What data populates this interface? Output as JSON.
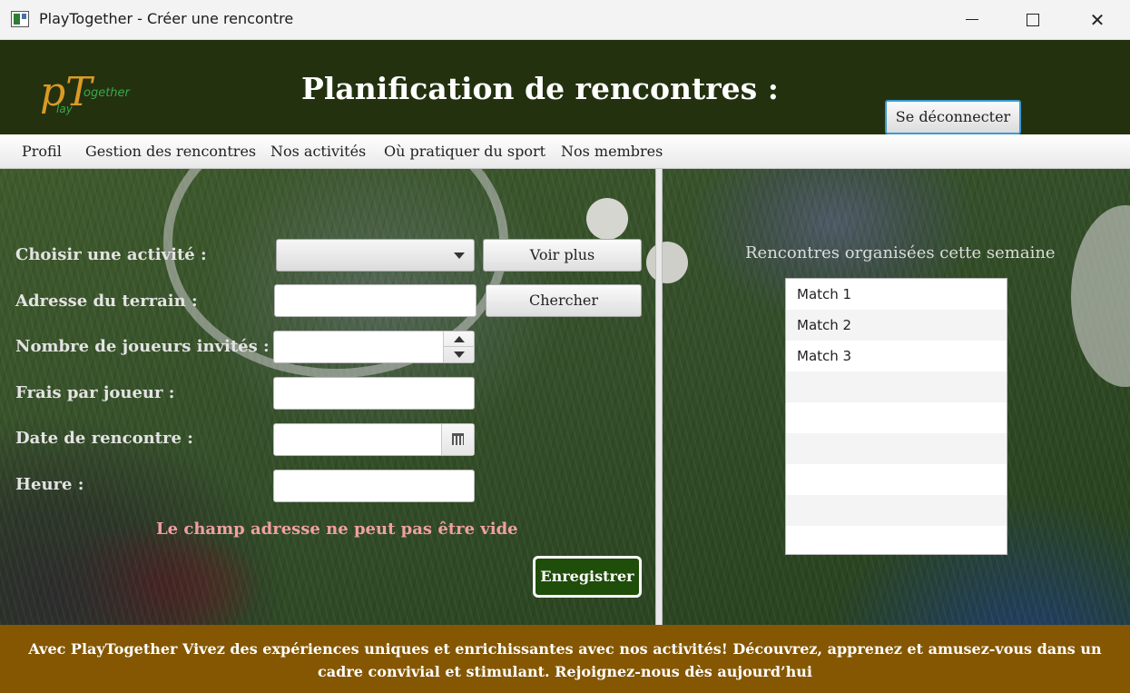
{
  "window": {
    "title": "PlayTogether - Créer une rencontre",
    "controls": [
      "minimize-icon",
      "maximize-icon",
      "close-icon"
    ],
    "close_glyph": "✕"
  },
  "header": {
    "logo_letters": "pT",
    "logo_together": "ogether",
    "logo_lay": "lay",
    "title": "Planification de rencontres :",
    "logout_label": "Se déconnecter",
    "background": "#23310f"
  },
  "menu": {
    "items": [
      "Profil",
      "Gestion des rencontres",
      "Nos activités",
      "Où pratiquer du sport",
      "Nos membres"
    ]
  },
  "form": {
    "activity_label": "Choisir une activité :",
    "activity_value": "",
    "voir_plus_label": "Voir plus",
    "address_label": "Adresse du terrain :",
    "address_value": "",
    "chercher_label": "Chercher",
    "players_label": "Nombre de joueurs invités :",
    "players_value": "",
    "fee_label": "Frais par joueur :",
    "fee_value": "",
    "date_label": "Date de rencontre :",
    "date_value": "",
    "time_label": "Heure :",
    "time_value": "",
    "error_message": "Le champ adresse ne peut pas être vide",
    "save_label": "Enregistrer"
  },
  "week_panel": {
    "title": "Rencontres organisées cette semaine",
    "matches": [
      "Match 1",
      "Match 2",
      "Match 3"
    ]
  },
  "footer": {
    "text": "Avec PlayTogether Vivez des expériences uniques et enrichissantes avec nos activités! Découvrez, apprenez et amusez-vous dans un cadre convivial et stimulant. Rejoignez-nous dès aujourd’hui",
    "background": "#855703"
  }
}
